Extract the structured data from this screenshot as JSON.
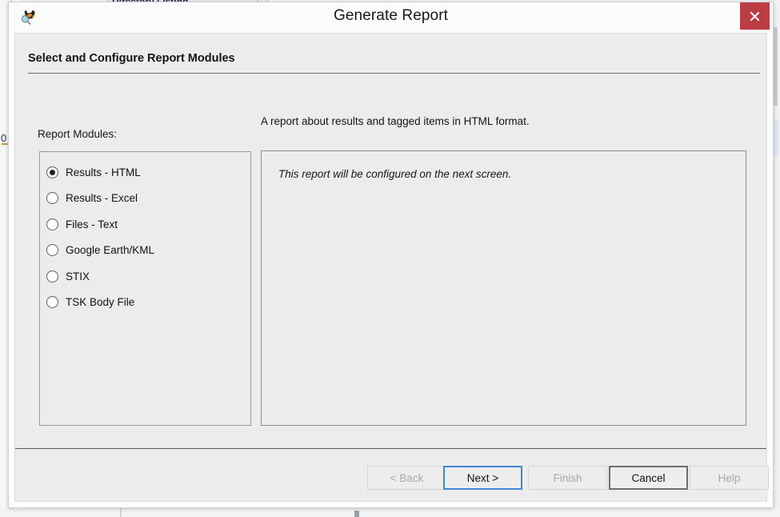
{
  "background": {
    "tab_label": "Directory Listing",
    "left_glyph": "0"
  },
  "window": {
    "title": "Generate Report",
    "app_icon": "autopsy-dog-icon",
    "close_icon": "close-icon",
    "close_label": "Close"
  },
  "header": {
    "step_title": "Select and Configure Report Modules"
  },
  "modules": {
    "label": "Report Modules:",
    "items": [
      {
        "label": "Results - HTML",
        "selected": true
      },
      {
        "label": "Results - Excel",
        "selected": false
      },
      {
        "label": "Files - Text",
        "selected": false
      },
      {
        "label": "Google Earth/KML",
        "selected": false
      },
      {
        "label": "STIX",
        "selected": false
      },
      {
        "label": "TSK Body File",
        "selected": false
      }
    ]
  },
  "details": {
    "description": "A report about results and tagged items in HTML format.",
    "config_note": "This report will be configured on the next screen."
  },
  "buttons": {
    "back": {
      "label": "< Back",
      "state": "disabled"
    },
    "next": {
      "label": "Next >",
      "state": "focused"
    },
    "finish": {
      "label": "Finish",
      "state": "disabled"
    },
    "cancel": {
      "label": "Cancel",
      "state": "default"
    },
    "help": {
      "label": "Help",
      "state": "disabled"
    }
  },
  "colors": {
    "close_red": "#bd3c44",
    "focus_blue": "#3f88d2",
    "dialog_face": "#ececec",
    "rule": "#6f6f6f"
  }
}
